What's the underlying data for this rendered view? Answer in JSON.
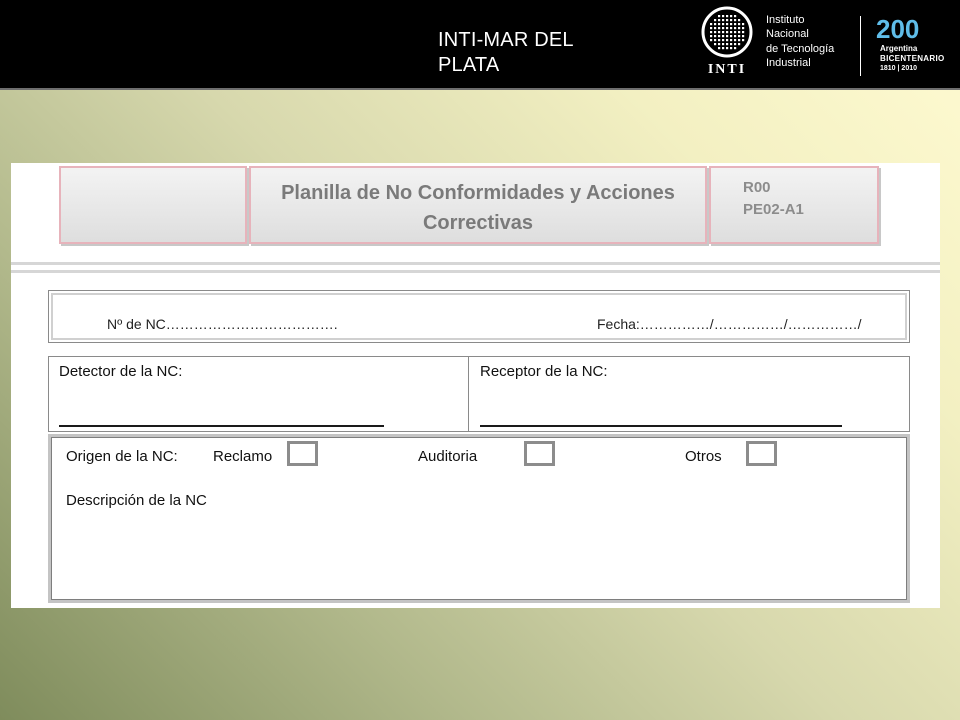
{
  "header": {
    "title": "INTI-MAR DEL PLATA",
    "inti_logo_text": "INTI",
    "institute_lines": [
      "Instituto",
      "Nacional",
      "de Tecnología",
      "Industrial"
    ],
    "bicentenario": {
      "number": "200",
      "country": "Argentina",
      "label": "BICENTENARIO",
      "years": "1810 | 2010"
    },
    "brand_color_bicentenario": "#5fbde9",
    "background_color": "#000000"
  },
  "document": {
    "title": "Planilla de No Conformidades y Acciones Correctivas",
    "revision": "R00",
    "code": "PE02-A1",
    "nc_number_label": "Nº  de NC……………………………….",
    "date_label": "Fecha:……………/……………/……………/",
    "detector_label": "Detector de la NC:",
    "receptor_label": "Receptor de la NC:",
    "origin_label": "Origen de la NC:",
    "origin_options": [
      "Reclamo",
      "Auditoria",
      "Otros"
    ],
    "description_label": "Descripción de la NC"
  }
}
